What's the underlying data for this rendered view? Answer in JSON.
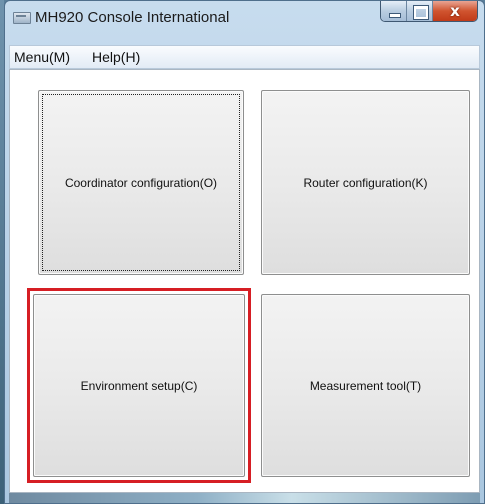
{
  "window": {
    "title": "MH920 Console International",
    "close_glyph": "x"
  },
  "menubar": {
    "items": [
      {
        "label": "Menu(M)"
      },
      {
        "label": "Help(H)"
      }
    ]
  },
  "buttons": {
    "coordinator": "Coordinator configuration(O)",
    "router": "Router configuration(K)",
    "environment": "Environment setup(C)",
    "measurement": "Measurement tool(T)"
  },
  "icons": {
    "app": "app-icon",
    "minimize": "minimize-icon",
    "maximize": "maximize-icon",
    "close": "close-icon"
  },
  "colors": {
    "highlight": "#d61e24",
    "close_button": "#c03a18"
  }
}
